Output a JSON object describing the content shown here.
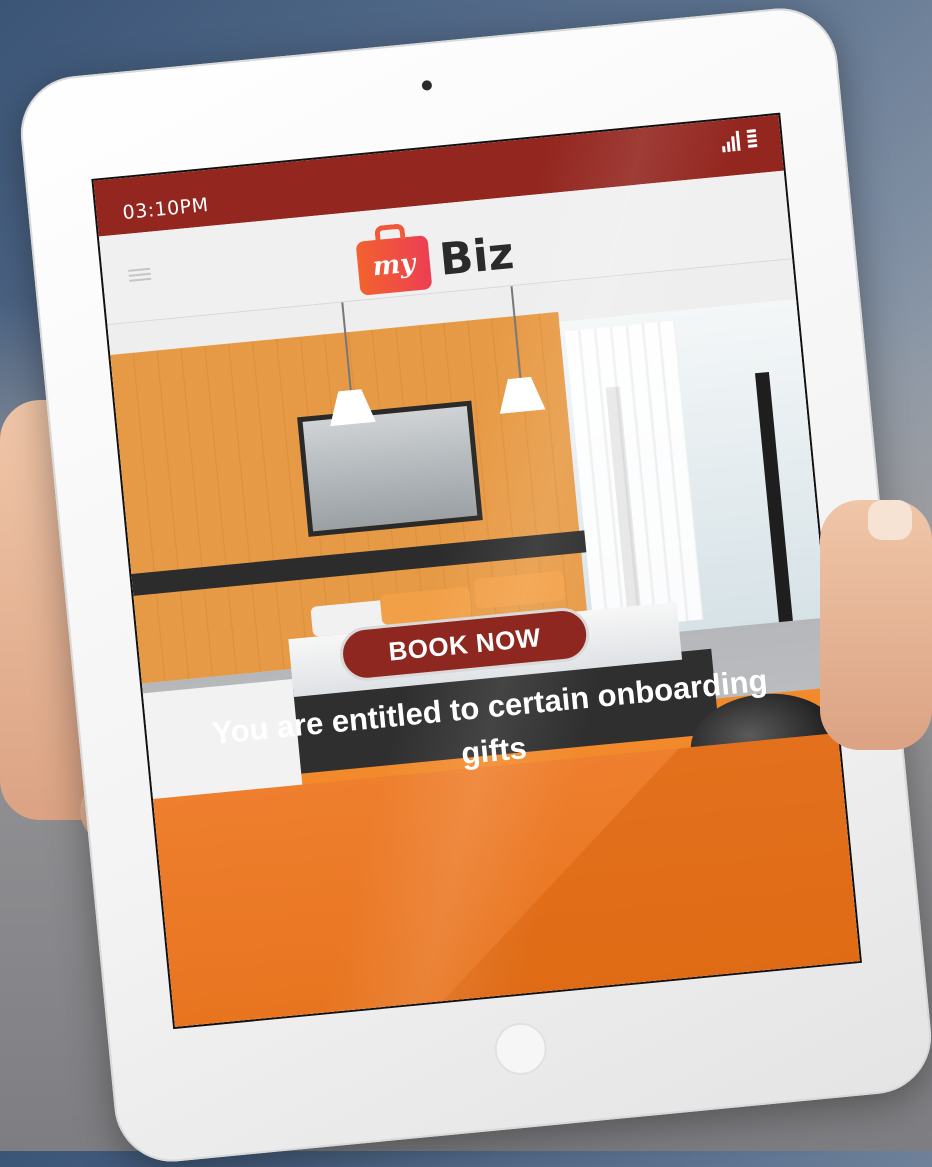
{
  "device": {
    "status_bar": {
      "time": "03:10PM",
      "signal_icon": "signal-bars-icon",
      "battery_icon": "battery-icon",
      "background": "#93261f"
    },
    "app_bar": {
      "menu_icon": "hamburger-menu-icon",
      "logo": {
        "badge_text": "my",
        "word": "Biz"
      }
    },
    "hero": {
      "image_description": "hotel-bedroom-photo"
    },
    "promo": {
      "cta_label": "BOOK NOW",
      "message": "You are entitled to certain onboarding gifts",
      "band_color": "#ee7f2e",
      "cta_color": "#8e271f"
    }
  }
}
